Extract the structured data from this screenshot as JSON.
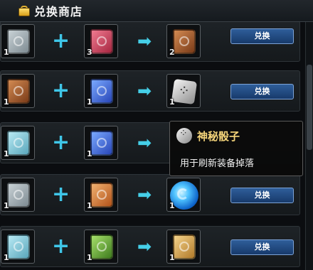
{
  "title": "兑换商店",
  "exchange_button": "兑换",
  "rows": [
    {
      "inputs": [
        {
          "item": "gray-book",
          "qty": "1"
        },
        {
          "item": "red-book",
          "qty": "3"
        }
      ],
      "output": {
        "item": "brown-book",
        "qty": "2"
      }
    },
    {
      "inputs": [
        {
          "item": "brown-book",
          "qty": "1"
        },
        {
          "item": "blue-book",
          "qty": "1"
        }
      ],
      "output": {
        "item": "mystery-dice",
        "qty": "1"
      }
    },
    {
      "inputs": [
        {
          "item": "teal-book",
          "qty": "1"
        },
        {
          "item": "blue-book",
          "qty": "1"
        }
      ],
      "output": {
        "item": "hidden",
        "qty": ""
      }
    },
    {
      "inputs": [
        {
          "item": "gray-book",
          "qty": "1"
        },
        {
          "item": "orange-book",
          "qty": "1"
        }
      ],
      "output": {
        "item": "blue-orb",
        "qty": "1"
      }
    },
    {
      "inputs": [
        {
          "item": "teal-book",
          "qty": "1"
        },
        {
          "item": "green-book",
          "qty": "1"
        }
      ],
      "output": {
        "item": "gold-book",
        "qty": "1"
      }
    }
  ],
  "tooltip": {
    "name": "神秘骰子",
    "description": "用于刷新装备掉落"
  },
  "colors": {
    "accent": "#45cfe8",
    "button": "#2f5e9a",
    "item_name": "#f4d47a"
  }
}
